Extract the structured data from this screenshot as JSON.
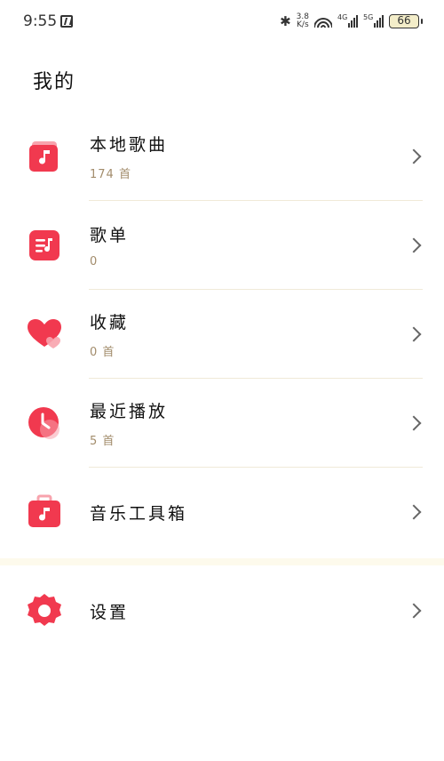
{
  "status": {
    "time": "9:55",
    "speed_value": "3.8",
    "speed_unit": "K/s",
    "net1": "4G",
    "net2": "5G",
    "battery": "66"
  },
  "page": {
    "title": "我的"
  },
  "menu": [
    {
      "label": "本地歌曲",
      "sub": "174 首",
      "icon": "music-note-icon"
    },
    {
      "label": "歌单",
      "sub": "0",
      "icon": "playlist-icon"
    },
    {
      "label": "收藏",
      "sub": "0 首",
      "icon": "heart-icon"
    },
    {
      "label": "最近播放",
      "sub": "5 首",
      "icon": "clock-icon"
    },
    {
      "label": "音乐工具箱",
      "sub": "",
      "icon": "toolbox-icon"
    }
  ],
  "settings": {
    "label": "设置",
    "icon": "gear-icon"
  },
  "colors": {
    "accent": "#f1394f",
    "subtext": "#a28c6b",
    "divider": "#f0ead8"
  }
}
